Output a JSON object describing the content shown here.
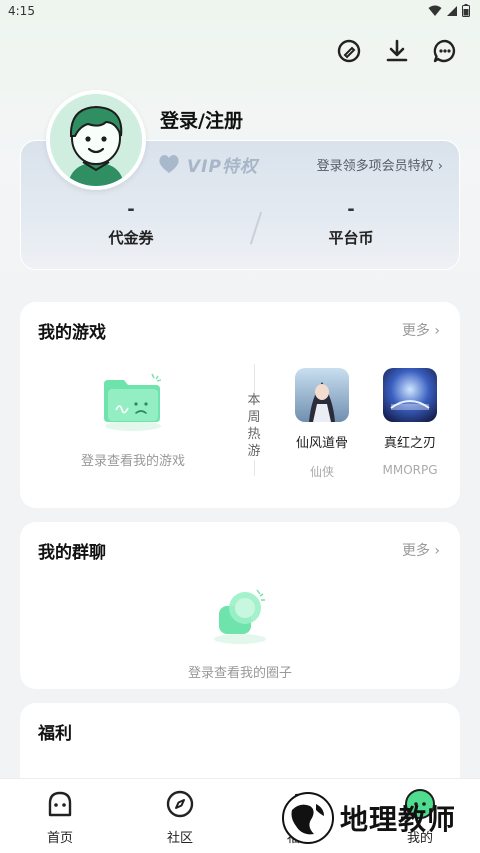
{
  "status": {
    "time": "4:15"
  },
  "profile": {
    "login_label": "登录/注册"
  },
  "vip": {
    "badge_text": "VIP特权",
    "promo_text": "登录领多项会员特权 ›"
  },
  "stats": [
    {
      "value": "-",
      "label": "代金券"
    },
    {
      "value": "-",
      "label": "平台币"
    }
  ],
  "my_games": {
    "title": "我的游戏",
    "more": "更多 ›",
    "empty_text": "登录查看我的游戏",
    "hot_label": "本周热游",
    "hot_games": [
      {
        "name": "仙风道骨",
        "tag": "仙侠"
      },
      {
        "name": "真红之刃",
        "tag": "MMORPG"
      }
    ]
  },
  "my_groups": {
    "title": "我的群聊",
    "more": "更多 ›",
    "empty_text": "登录查看我的圈子"
  },
  "welfare": {
    "title": "福利"
  },
  "tabbar": {
    "items": [
      {
        "label": "首页"
      },
      {
        "label": "社区"
      },
      {
        "label": "福利"
      },
      {
        "label": "我的"
      }
    ]
  },
  "watermark": {
    "text": "地理教师"
  }
}
